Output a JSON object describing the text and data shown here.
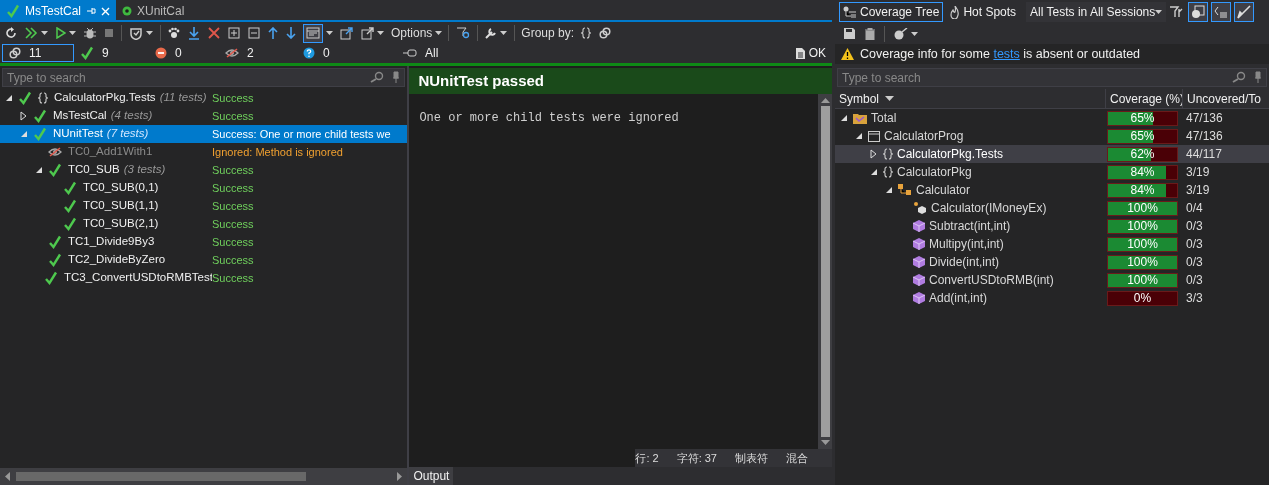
{
  "doc_tabs": [
    {
      "label": "MsTestCal",
      "selected": true,
      "kind": "passed"
    },
    {
      "label": "XUnitCal",
      "selected": false,
      "kind": "running"
    }
  ],
  "toolbar": {
    "options_label": "Options",
    "group_by_label": "Group by:",
    "details_view_on": true
  },
  "counters": [
    {
      "kind": "total",
      "value": "11",
      "selected": true
    },
    {
      "kind": "passed",
      "value": "9",
      "selected": false
    },
    {
      "kind": "failed",
      "value": "0",
      "selected": false
    },
    {
      "kind": "ignored",
      "value": "2",
      "selected": false
    },
    {
      "kind": "inconclusive",
      "value": "0",
      "selected": false
    },
    {
      "kind": "all",
      "value": "All",
      "selected": false
    }
  ],
  "run_status": "OK",
  "test_search": {
    "placeholder": "Type to search"
  },
  "test_tree": [
    {
      "name": "CalculatorPkg.Tests",
      "count": "(11 tests)",
      "result": "Success",
      "kind": "success",
      "namespace": true,
      "expanded": true,
      "selected": false,
      "children": [
        {
          "name": "MsTestCal",
          "count": "(4 tests)",
          "result": "Success",
          "kind": "success",
          "expanded": false,
          "selected": false
        },
        {
          "name": "NUnitTest",
          "count": "(7 tests)",
          "result": "Success: One or more child tests we",
          "kind": "success",
          "expanded": true,
          "selected": true,
          "children": [
            {
              "name": "TC0_Add1With1",
              "result": "Ignored: Method is ignored",
              "kind": "ignored",
              "selected": false
            },
            {
              "name": "TC0_SUB",
              "count": "(3 tests)",
              "result": "Success",
              "kind": "success",
              "expanded": true,
              "selected": false,
              "children": [
                {
                  "name": "TC0_SUB(0,1)",
                  "result": "Success",
                  "kind": "success",
                  "selected": false
                },
                {
                  "name": "TC0_SUB(1,1)",
                  "result": "Success",
                  "kind": "success",
                  "selected": false
                },
                {
                  "name": "TC0_SUB(2,1)",
                  "result": "Success",
                  "kind": "success",
                  "selected": false
                }
              ]
            },
            {
              "name": "TC1_Divide9By3",
              "result": "Success",
              "kind": "success",
              "selected": false
            },
            {
              "name": "TC2_DivideByZero",
              "result": "Success",
              "kind": "success",
              "selected": false
            },
            {
              "name": "TC3_ConvertUSDtoRMBTest",
              "result": "Success",
              "kind": "success",
              "selected": false
            }
          ]
        }
      ]
    }
  ],
  "result_pane": {
    "title": "NUnitTest passed",
    "message": "One or more child tests were ignored",
    "status_items": [
      "行: 2",
      "字符: 37",
      "制表符",
      "混合"
    ],
    "output_tab": "Output"
  },
  "coverage": {
    "tabs": [
      {
        "label": "Coverage Tree",
        "selected": true
      },
      {
        "label": "Hot Spots",
        "selected": false
      }
    ],
    "scope": "All Tests in All Sessions",
    "view_toggles": [
      {
        "selected": true
      },
      {
        "selected": true
      },
      {
        "selected": true
      }
    ],
    "warning": {
      "before": "Coverage info for some ",
      "link": "tests",
      "after": " is absent or outdated"
    },
    "search": {
      "placeholder": "Type to search"
    },
    "columns": [
      "Symbol",
      "Coverage (%)",
      "Uncovered/To"
    ],
    "rows": [
      {
        "kind": "total",
        "name": "Total",
        "level": 0.65,
        "percent": "65%",
        "uncovered": "47/136",
        "expanded": true,
        "selected": false,
        "children": [
          {
            "kind": "project",
            "name": "CalculatorProg",
            "level": 0.65,
            "percent": "65%",
            "uncovered": "47/136",
            "expanded": true,
            "selected": false,
            "children": [
              {
                "kind": "namespace",
                "name": "CalculatorPkg.Tests",
                "level": 0.62,
                "percent": "62%",
                "uncovered": "44/117",
                "expanded": false,
                "selected": true
              },
              {
                "kind": "namespace",
                "name": "CalculatorPkg",
                "level": 0.84,
                "percent": "84%",
                "uncovered": "3/19",
                "expanded": true,
                "selected": false,
                "children": [
                  {
                    "kind": "class",
                    "name": "Calculator",
                    "level": 0.84,
                    "percent": "84%",
                    "uncovered": "3/19",
                    "expanded": true,
                    "selected": false,
                    "children": [
                      {
                        "kind": "constructor",
                        "name": "Calculator(IMoneyEx)",
                        "level": 1,
                        "percent": "100%",
                        "uncovered": "0/4",
                        "selected": false
                      },
                      {
                        "kind": "method",
                        "name": "Subtract(int,int)",
                        "level": 1,
                        "percent": "100%",
                        "uncovered": "0/3",
                        "selected": false
                      },
                      {
                        "kind": "method",
                        "name": "Multipy(int,int)",
                        "level": 1,
                        "percent": "100%",
                        "uncovered": "0/3",
                        "selected": false
                      },
                      {
                        "kind": "method",
                        "name": "Divide(int,int)",
                        "level": 1,
                        "percent": "100%",
                        "uncovered": "0/3",
                        "selected": false
                      },
                      {
                        "kind": "method",
                        "name": "ConvertUSDtoRMB(int)",
                        "level": 1,
                        "percent": "100%",
                        "uncovered": "0/3",
                        "selected": false
                      },
                      {
                        "kind": "method",
                        "name": "Add(int,int)",
                        "level": 0,
                        "percent": "0%",
                        "uncovered": "3/3",
                        "selected": false
                      }
                    ]
                  }
                ]
              }
            ]
          }
        ]
      }
    ]
  }
}
